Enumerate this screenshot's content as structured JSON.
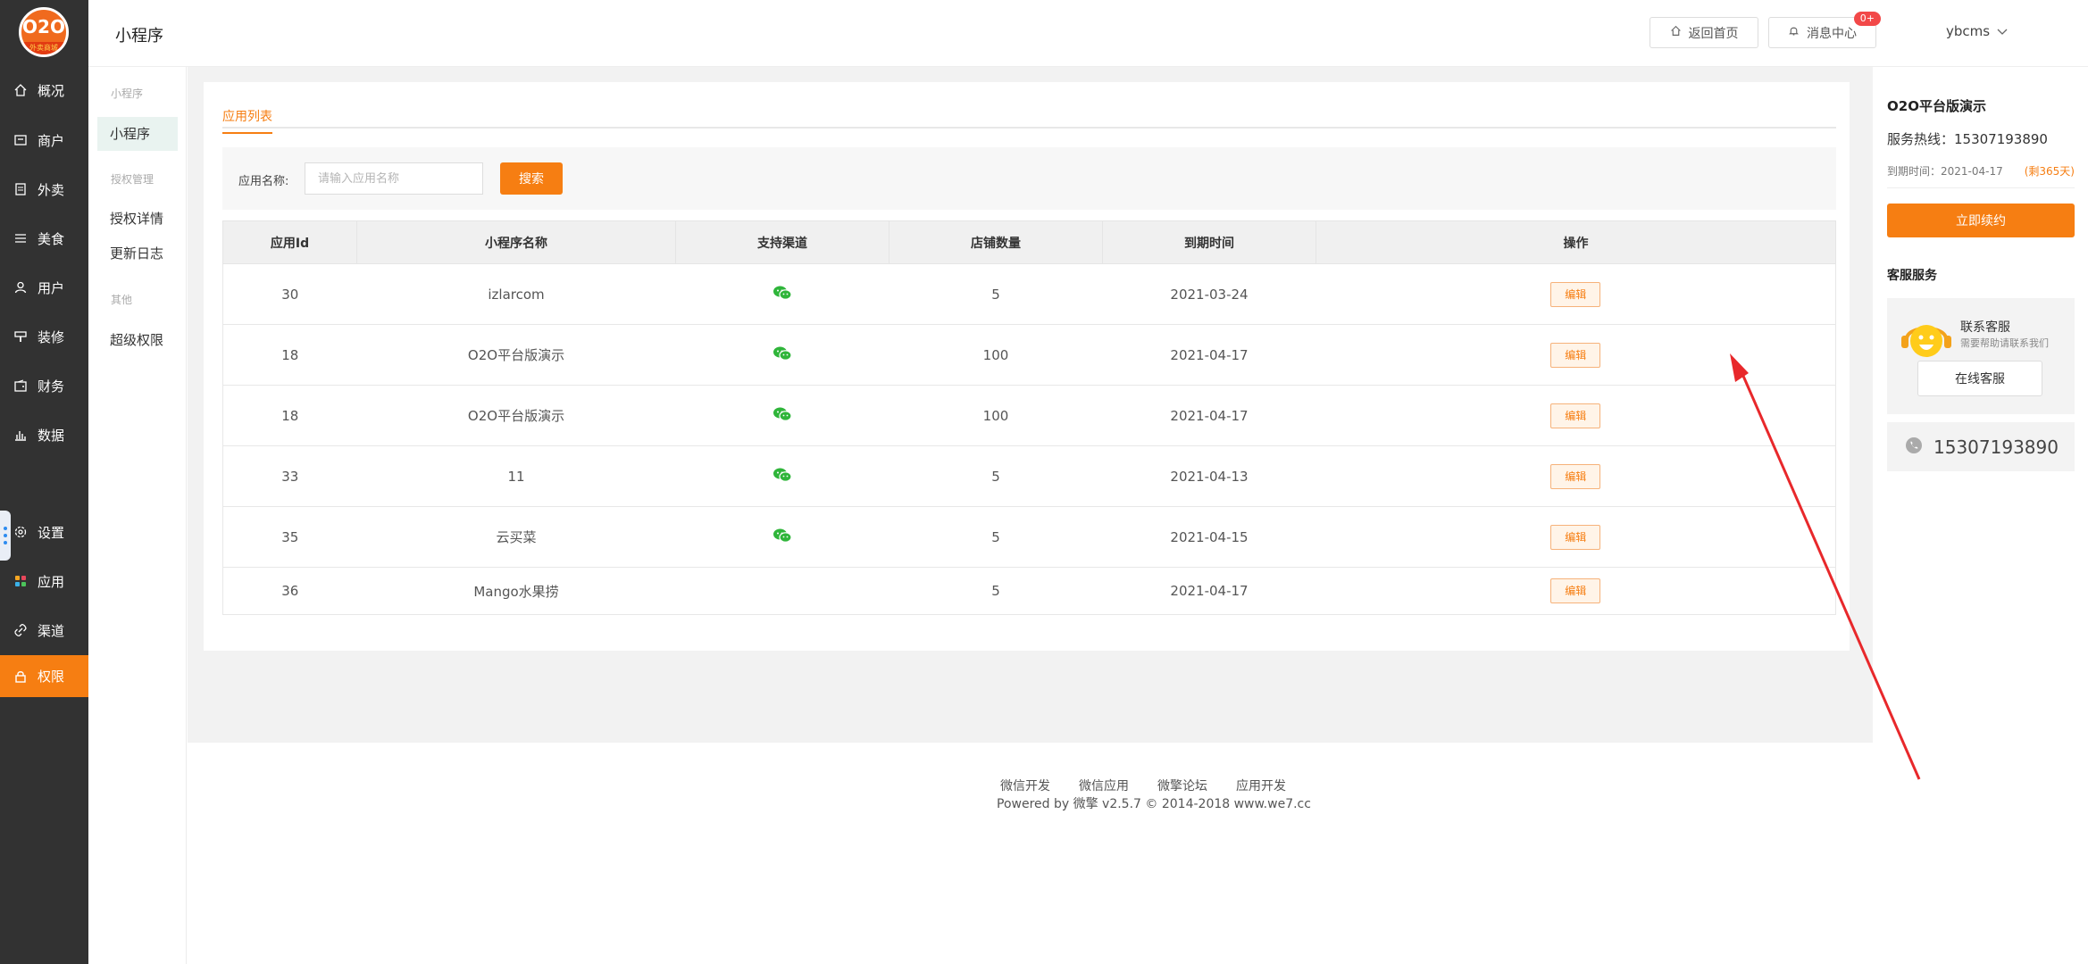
{
  "logo": {
    "main": "O2O",
    "sub": "外卖商城"
  },
  "nav": [
    {
      "label": "概况",
      "icon": "home-icon"
    },
    {
      "label": "商户",
      "icon": "store-icon"
    },
    {
      "label": "外卖",
      "icon": "document-icon"
    },
    {
      "label": "美食",
      "icon": "menu-icon"
    },
    {
      "label": "用户",
      "icon": "user-icon"
    },
    {
      "label": "装修",
      "icon": "brush-icon"
    },
    {
      "label": "财务",
      "icon": "wallet-icon"
    },
    {
      "label": "数据",
      "icon": "chart-icon"
    },
    {
      "label": "设置",
      "icon": "gear-icon"
    },
    {
      "label": "应用",
      "icon": "apps-icon"
    },
    {
      "label": "渠道",
      "icon": "link-icon"
    },
    {
      "label": "权限",
      "icon": "lock-icon"
    }
  ],
  "subnav": {
    "group1": "小程序",
    "item_miniapp": "小程序",
    "group2": "授权管理",
    "item_auth_detail": "授权详情",
    "item_changelog": "更新日志",
    "group3": "其他",
    "item_super": "超级权限"
  },
  "header": {
    "title": "小程序",
    "home_label": "返回首页",
    "message_label": "消息中心",
    "message_badge": "0+",
    "user": "ybcms"
  },
  "tabs": {
    "active": "应用列表"
  },
  "filter": {
    "label": "应用名称:",
    "placeholder": "请输入应用名称",
    "search_label": "搜索"
  },
  "table": {
    "columns": [
      "应用Id",
      "小程序名称",
      "支持渠道",
      "店铺数量",
      "到期时间",
      "操作"
    ],
    "edit_label": "编辑",
    "rows": [
      {
        "id": "30",
        "name": "izlarcom",
        "wechat": true,
        "stores": "5",
        "expire": "2021-03-24"
      },
      {
        "id": "18",
        "name": "O2O平台版演示",
        "wechat": true,
        "stores": "100",
        "expire": "2021-04-17"
      },
      {
        "id": "18",
        "name": "O2O平台版演示",
        "wechat": true,
        "stores": "100",
        "expire": "2021-04-17"
      },
      {
        "id": "33",
        "name": "11",
        "wechat": true,
        "stores": "5",
        "expire": "2021-04-13"
      },
      {
        "id": "35",
        "name": "云买菜",
        "wechat": true,
        "stores": "5",
        "expire": "2021-04-15"
      },
      {
        "id": "36",
        "name": "Mango水果捞",
        "wechat": false,
        "stores": "5",
        "expire": "2021-04-17"
      }
    ]
  },
  "right": {
    "title": "O2O平台版演示",
    "hotline": "服务热线：15307193890",
    "expire": "到期时间：2021-04-17",
    "remaining": "(剩365天)",
    "renew_label": "立即续约",
    "service_title": "客服服务",
    "contact_name": "联系客服",
    "contact_desc": "需要帮助请联系我们",
    "online_label": "在线客服",
    "phone": "15307193890"
  },
  "footer": {
    "links": [
      "微信开发",
      "微信应用",
      "微擎论坛",
      "应用开发"
    ],
    "copyright": "Powered by 微擎 v2.5.7 © 2014-2018 www.we7.cc"
  },
  "colors": {
    "accent": "#f67e12",
    "sidebar": "#323232",
    "wechat": "#2fb53a",
    "annotation": "#e8282b"
  }
}
